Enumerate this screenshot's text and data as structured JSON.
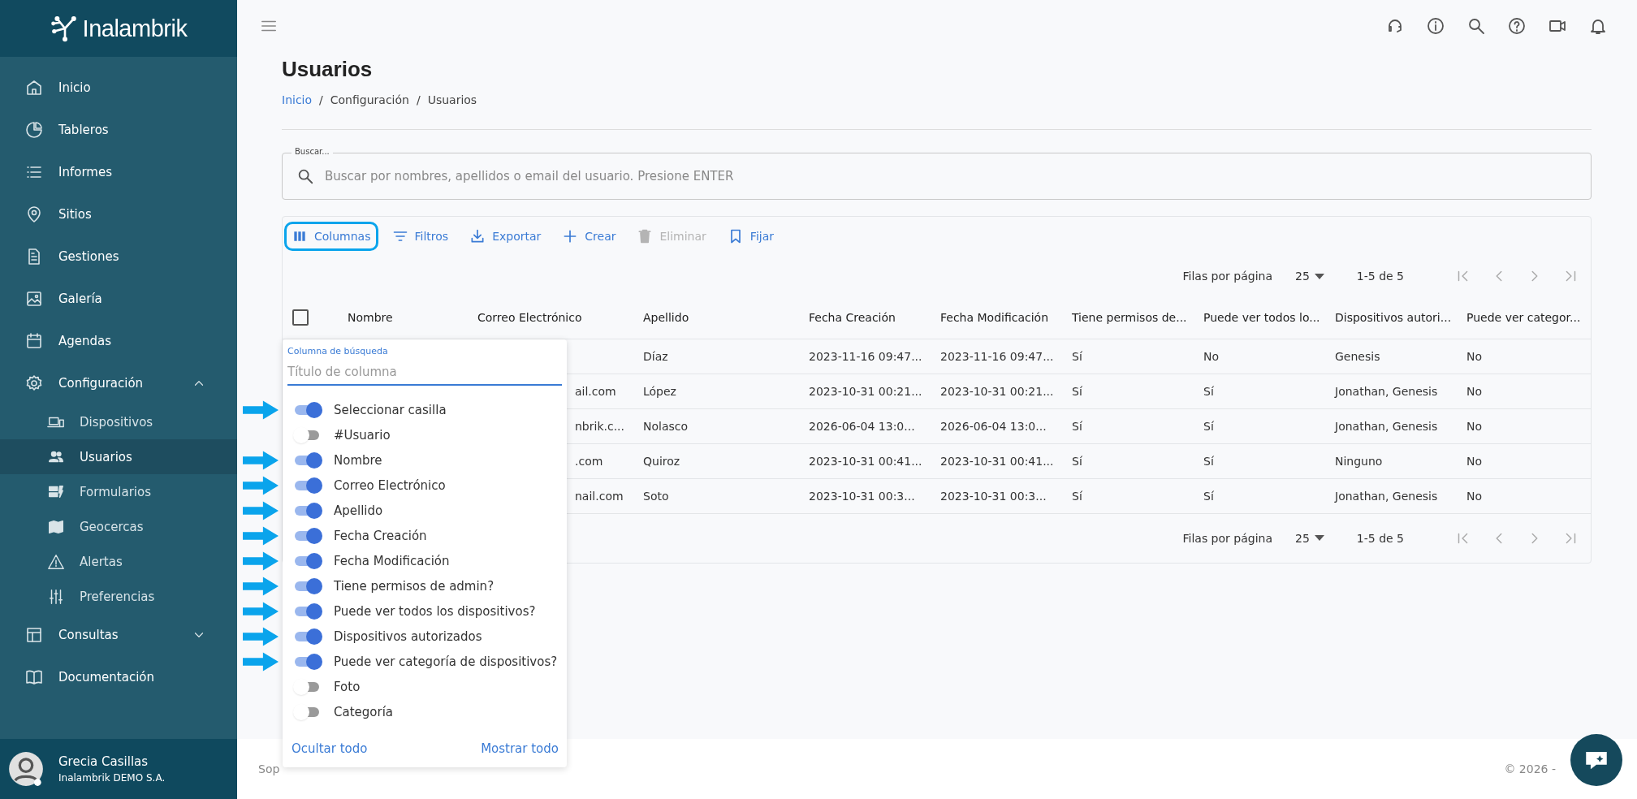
{
  "sidebar": {
    "logo": "Inalambrik",
    "items": [
      {
        "label": "Inicio",
        "kind": "home",
        "selected": false
      },
      {
        "label": "Tableros",
        "kind": "pie",
        "selected": false
      },
      {
        "label": "Informes",
        "kind": "list",
        "selected": false
      },
      {
        "label": "Sitios",
        "kind": "pin",
        "selected": false
      },
      {
        "label": "Gestiones",
        "kind": "doc",
        "selected": false
      },
      {
        "label": "Galería",
        "kind": "image",
        "selected": false
      },
      {
        "label": "Agendas",
        "kind": "calendar",
        "selected": false
      },
      {
        "label": "Configuración",
        "kind": "gear",
        "selected": false,
        "expanded": true,
        "children": [
          {
            "label": "Dispositivos",
            "kind": "devices",
            "selected": false
          },
          {
            "label": "Usuarios",
            "kind": "people",
            "selected": true
          },
          {
            "label": "Formularios",
            "kind": "form",
            "selected": false
          },
          {
            "label": "Geocercas",
            "kind": "map",
            "selected": false
          },
          {
            "label": "Alertas",
            "kind": "warning",
            "selected": false
          },
          {
            "label": "Preferencias",
            "kind": "sliders",
            "selected": false
          }
        ]
      },
      {
        "label": "Consultas",
        "kind": "table",
        "selected": false,
        "expanded": false
      },
      {
        "label": "Documentación",
        "kind": "book",
        "selected": false
      }
    ],
    "user": {
      "name": "Grecia Casillas",
      "company": "Inalambrik DEMO S.A."
    }
  },
  "page": {
    "title": "Usuarios",
    "breadcrumb": [
      {
        "label": "Inicio",
        "link": true
      },
      {
        "separator": "/",
        "label": "Configuración",
        "link": false
      },
      {
        "separator": "/",
        "label": "Usuarios",
        "link": false
      }
    ]
  },
  "search": {
    "label": "Buscar...",
    "placeholder": "Buscar por nombres, apellidos o email del usuario. Presione ENTER"
  },
  "toolbar": [
    {
      "label": "Columnas",
      "kind": "columns",
      "disabled": false,
      "highlighted": true
    },
    {
      "label": "Filtros",
      "kind": "filter",
      "disabled": false,
      "highlighted": false
    },
    {
      "label": "Exportar",
      "kind": "export",
      "disabled": false,
      "highlighted": false
    },
    {
      "label": "Crear",
      "kind": "create",
      "disabled": false,
      "highlighted": false
    },
    {
      "label": "Eliminar",
      "kind": "delete",
      "disabled": true,
      "highlighted": false
    },
    {
      "label": "Fijar",
      "kind": "pin",
      "disabled": false,
      "highlighted": false
    }
  ],
  "pagination_top": {
    "rows_label": "Filas por página",
    "rows_value": "25",
    "range": "1-5 de 5"
  },
  "table": {
    "select_all": {
      "checked": false
    },
    "columns": [
      "Nombre",
      "Correo Electrónico",
      "Apellido",
      "Fecha Creación",
      "Fecha Modificación",
      "Tiene permisos de...",
      "Puede ver todos lo...",
      "Dispositivos autori...",
      "Puede ver categor..."
    ],
    "rows": [
      {
        "cells": [
          null,
          null,
          "Díaz",
          "2023-11-16 09:47...",
          "2023-11-16 09:47...",
          "Sí",
          "No",
          "Genesis",
          "No"
        ]
      },
      {
        "cells": [
          null,
          "ail.com",
          "López",
          "2023-10-31 00:21...",
          "2023-10-31 00:21...",
          "Sí",
          "Sí",
          "Jonathan, Genesis",
          "No"
        ]
      },
      {
        "cells": [
          null,
          "nbrik.c...",
          "Nolasco",
          "2026-06-04 13:0...",
          "2026-06-04 13:0...",
          "Sí",
          "Sí",
          "Jonathan, Genesis",
          "No"
        ]
      },
      {
        "cells": [
          null,
          ".com",
          "Quiroz",
          "2023-10-31 00:41...",
          "2023-10-31 00:41...",
          "Sí",
          "Sí",
          "Ninguno",
          "No"
        ]
      },
      {
        "cells": [
          null,
          "nail.com",
          "Soto",
          "2023-10-31 00:3...",
          "2023-10-31 00:3...",
          "Sí",
          "Sí",
          "Jonathan, Genesis",
          "No"
        ]
      }
    ]
  },
  "pagination_bottom": {
    "rows_label": "Filas por página",
    "rows_value": "25",
    "range": "1-5 de 5"
  },
  "columns_panel": {
    "search_label": "Columna de búsqueda",
    "placeholder": "Título de columna",
    "items": [
      {
        "label": "Seleccionar casilla",
        "on": true,
        "arrow": true
      },
      {
        "label": "#Usuario",
        "on": false,
        "arrow": false
      },
      {
        "label": "Nombre",
        "on": true,
        "arrow": true
      },
      {
        "label": "Correo Electrónico",
        "on": true,
        "arrow": true
      },
      {
        "label": "Apellido",
        "on": true,
        "arrow": true
      },
      {
        "label": "Fecha Creación",
        "on": true,
        "arrow": true
      },
      {
        "label": "Fecha Modificación",
        "on": true,
        "arrow": true
      },
      {
        "label": "Tiene permisos de admin?",
        "on": true,
        "arrow": true
      },
      {
        "label": "Puede ver todos los dispositivos?",
        "on": true,
        "arrow": true
      },
      {
        "label": "Dispositivos autorizados",
        "on": true,
        "arrow": true
      },
      {
        "label": "Puede ver categoría de dispositivos?",
        "on": true,
        "arrow": true
      },
      {
        "label": "Foto",
        "on": false,
        "arrow": false
      },
      {
        "label": "Categoría",
        "on": false,
        "arrow": false
      }
    ],
    "hide_all": "Ocultar todo",
    "show_all": "Mostrar todo"
  },
  "footer": {
    "left": "Sop",
    "right": "© 2026 -"
  }
}
